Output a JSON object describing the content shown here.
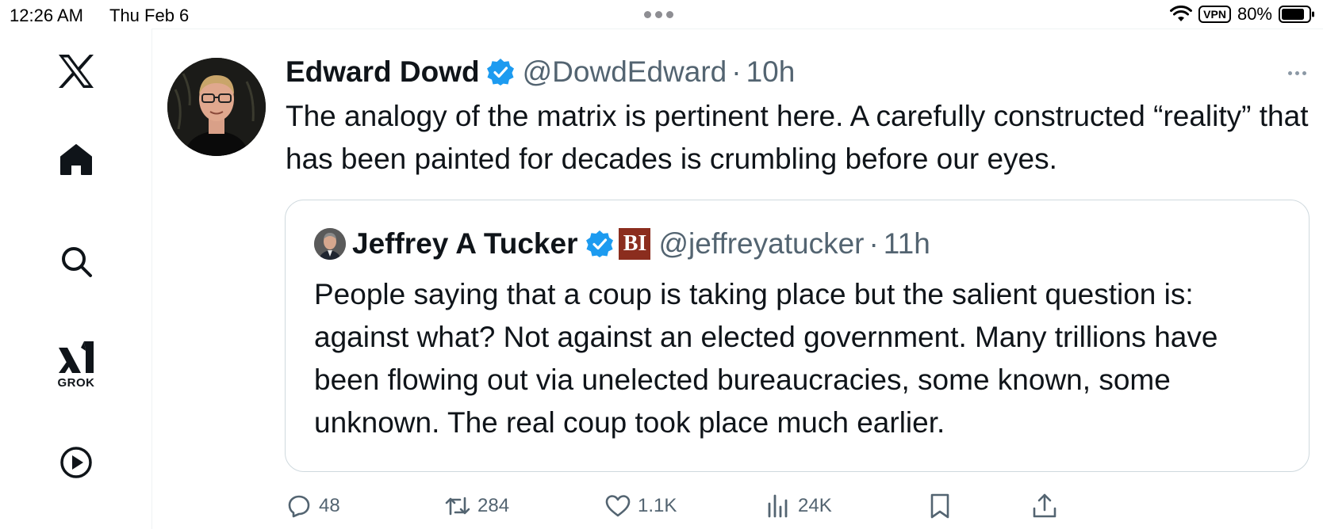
{
  "status_bar": {
    "time": "12:26 AM",
    "date": "Thu Feb 6",
    "vpn": "VPN",
    "battery": "80%"
  },
  "sidebar": {
    "items": [
      {
        "name": "x-logo-icon"
      },
      {
        "name": "home-icon"
      },
      {
        "name": "search-icon"
      },
      {
        "name": "grok-icon",
        "label": "GROK"
      },
      {
        "name": "video-icon"
      }
    ]
  },
  "tweet": {
    "author_name": "Edward Dowd",
    "handle": "@DowdEdward",
    "separator": "·",
    "time": "10h",
    "text": "The analogy of the matrix is pertinent here. A carefully constructed “reality” that has been painted for decades is crumbling before our eyes.",
    "quoted": {
      "author_name": "Jeffrey A Tucker",
      "badge": "BI",
      "handle": "@jeffreyatucker",
      "separator": "·",
      "time": "11h",
      "text": "People saying that a coup is taking place but the salient question is: against what? Not against an elected government. Many trillions have been flowing out via unelected bureaucracies, some known, some unknown. The real coup took place much earlier."
    },
    "actions": {
      "replies": "48",
      "reposts": "284",
      "likes": "1.1K",
      "views": "24K"
    }
  },
  "colors": {
    "verified": "#1d9bf0",
    "secondary_text": "#536471",
    "primary_text": "#0f1419",
    "badge_bg": "#8b2d1e"
  }
}
